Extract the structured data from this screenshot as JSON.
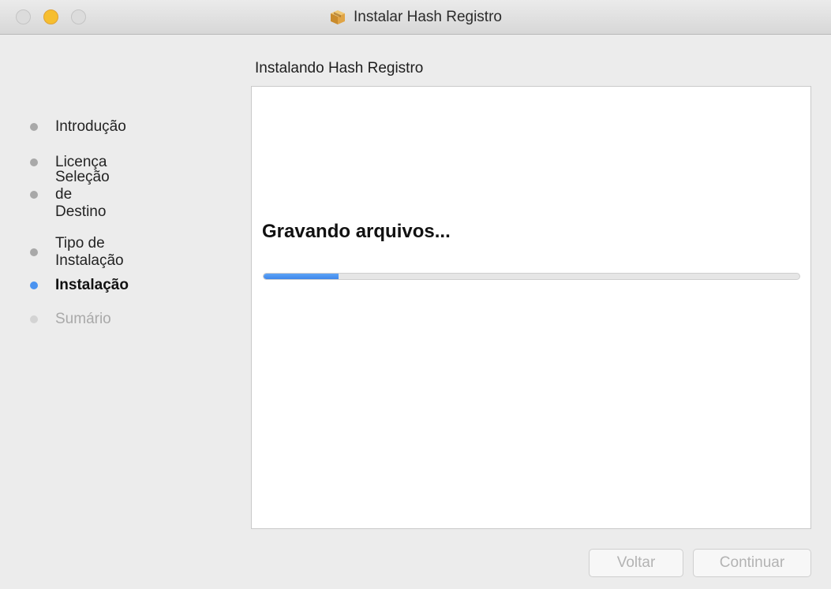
{
  "window": {
    "title": "Instalar Hash Registro",
    "title_icon": "package-icon"
  },
  "panel": {
    "heading": "Instalando Hash Registro",
    "status_text": "Gravando arquivos...",
    "progress_fraction": 0.14
  },
  "sidebar": {
    "steps": [
      {
        "label": "Introdução",
        "state": "done"
      },
      {
        "label": "Licença",
        "state": "done"
      },
      {
        "label": "Seleção de Destino",
        "state": "done"
      },
      {
        "label": "Tipo de Instalação",
        "state": "done"
      },
      {
        "label": "Instalação",
        "state": "active"
      },
      {
        "label": "Sumário",
        "state": "pending"
      }
    ]
  },
  "buttons": {
    "back_label": "Voltar",
    "continue_label": "Continuar"
  },
  "colors": {
    "accent": "#4a93f0",
    "minimize_button": "#f6be2f"
  }
}
